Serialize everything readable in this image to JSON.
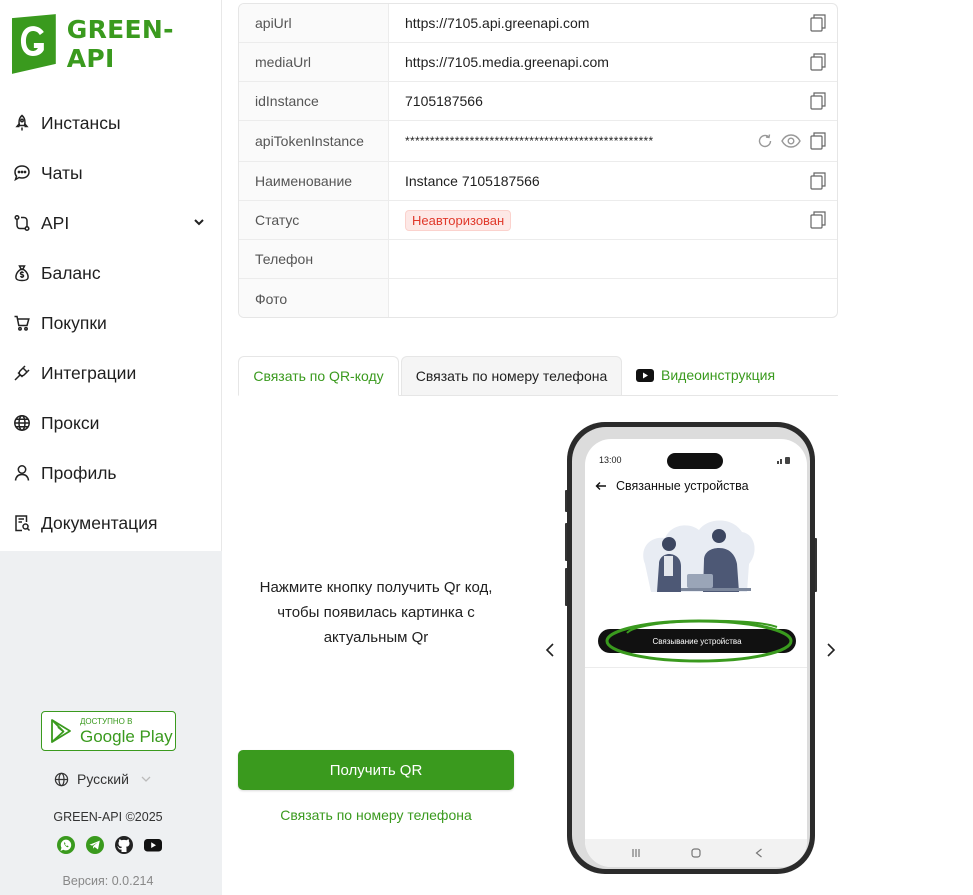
{
  "brand": {
    "name": "GREEN-API",
    "accent": "#3a9a1e"
  },
  "sidebar": {
    "items": [
      {
        "label": "Инстансы",
        "icon": "rocket-icon"
      },
      {
        "label": "Чаты",
        "icon": "chat-icon"
      },
      {
        "label": "API",
        "icon": "route-icon",
        "has_chevron": true
      },
      {
        "label": "Баланс",
        "icon": "money-bag-icon"
      },
      {
        "label": "Покупки",
        "icon": "cart-icon"
      },
      {
        "label": "Интеграции",
        "icon": "plug-icon"
      },
      {
        "label": "Прокси",
        "icon": "globe-icon"
      },
      {
        "label": "Профиль",
        "icon": "user-icon"
      },
      {
        "label": "Документация",
        "icon": "document-search-icon"
      }
    ],
    "google_play": {
      "small": "Доступно в",
      "big": "Google Play"
    },
    "language": "Русский",
    "copyright": "GREEN-API ©2025",
    "socials": [
      "whatsapp-icon",
      "telegram-icon",
      "github-icon",
      "youtube-icon"
    ],
    "version": "Версия: 0.0.214"
  },
  "instance": {
    "rows": [
      {
        "key": "apiUrl",
        "value": "https://7105.api.greenapi.com"
      },
      {
        "key": "mediaUrl",
        "value": "https://7105.media.greenapi.com"
      },
      {
        "key": "idInstance",
        "value": "7105187566"
      },
      {
        "key": "apiTokenInstance",
        "value": "**************************************************"
      },
      {
        "key": "Наименование",
        "value": "Instance 7105187566"
      },
      {
        "key": "Статус",
        "value": "Неавторизован"
      },
      {
        "key": "Телефон",
        "value": ""
      },
      {
        "key": "Фото",
        "value": ""
      }
    ],
    "status_color": "#e0392b"
  },
  "tabs": {
    "qr": "Связать по QR-коду",
    "phone": "Связать по номеру телефона",
    "video": "Видеоинструкция"
  },
  "qr_panel": {
    "instruction": "Нажмите кнопку получить Qr код, чтобы появилась картинка с актуальным Qr",
    "button": "Получить QR",
    "phone_link": "Связать по номеру телефона"
  },
  "phone_preview": {
    "time": "13:00",
    "header": "Связанные устройства",
    "link_button": "Связывание устройства"
  }
}
